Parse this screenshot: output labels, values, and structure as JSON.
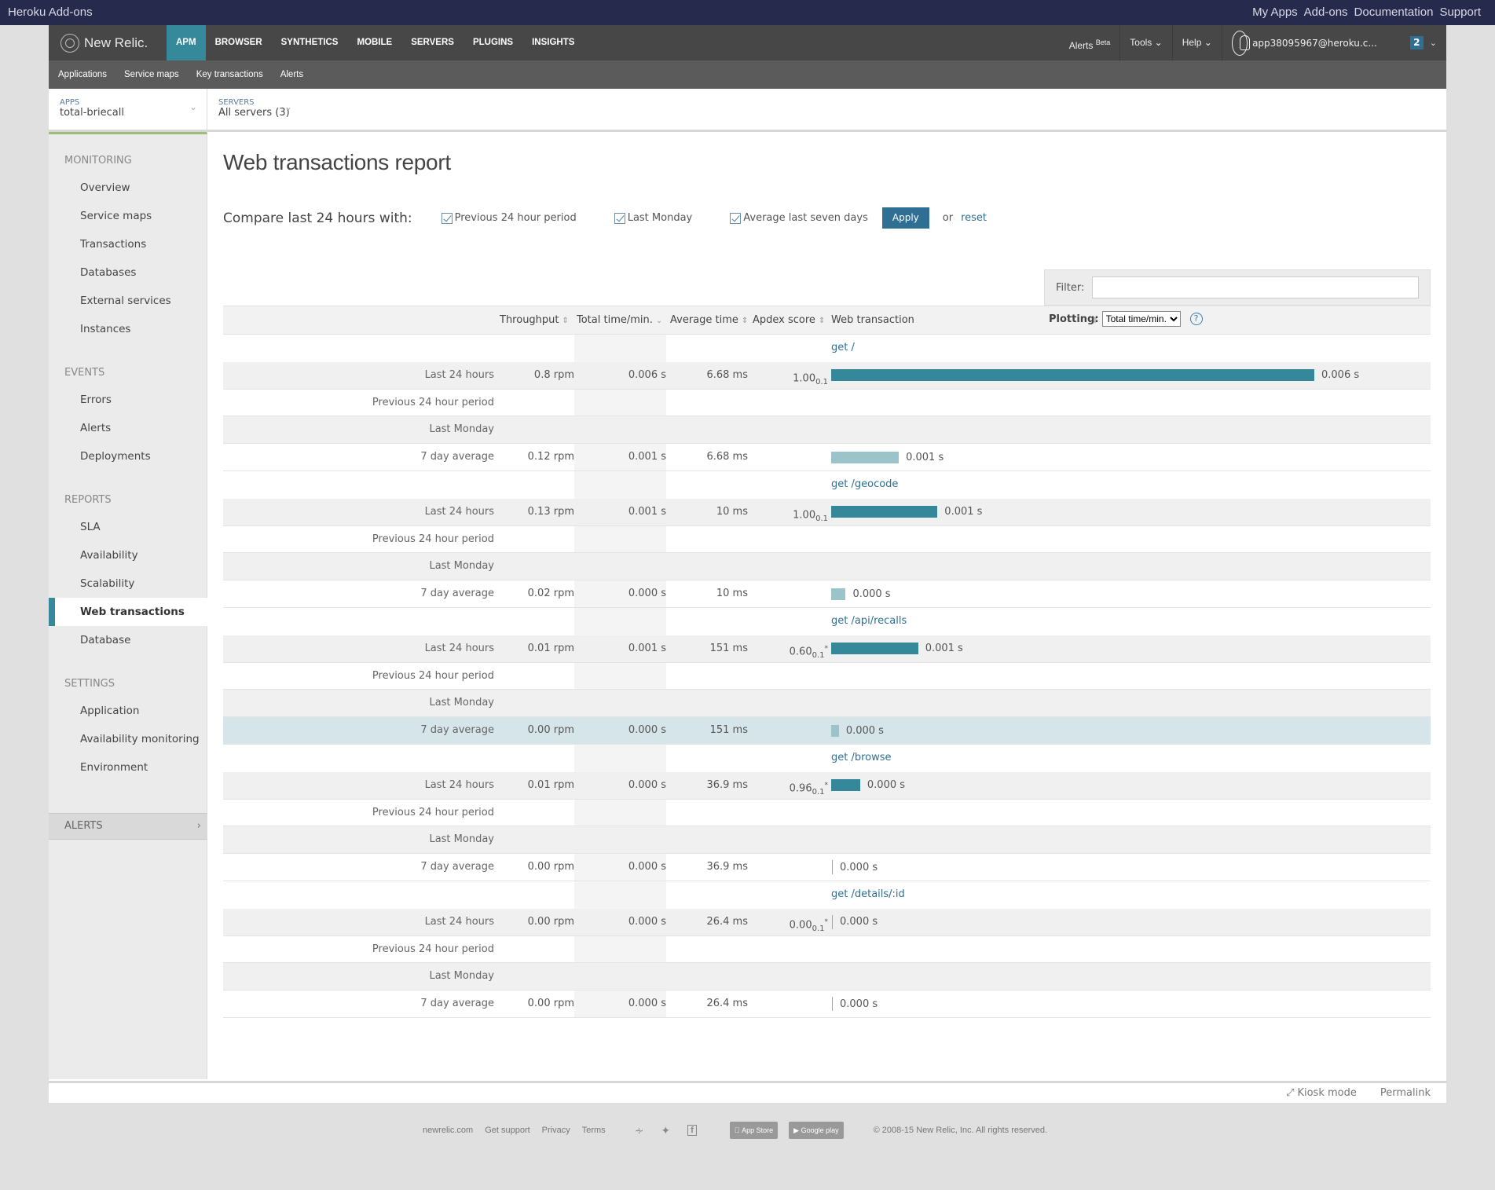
{
  "heroku": {
    "title": "Heroku Add-ons",
    "links": [
      "My Apps",
      "Add-ons",
      "Documentation",
      "Support"
    ]
  },
  "topnav": {
    "brand": "New Relic.",
    "tabs": [
      "APM",
      "BROWSER",
      "SYNTHETICS",
      "MOBILE",
      "SERVERS",
      "PLUGINS",
      "INSIGHTS"
    ],
    "active_tab": "APM",
    "alerts": "Alerts",
    "alerts_badge": "Beta",
    "tools": "Tools",
    "help": "Help",
    "user": "app38095967@heroku.c...",
    "notifications": "2"
  },
  "subnav": [
    "Applications",
    "Service maps",
    "Key transactions",
    "Alerts"
  ],
  "selectors": {
    "apps_label": "APPS",
    "apps_value": "total-briecall",
    "servers_label": "SERVERS",
    "servers_value": "All servers (3)"
  },
  "sidebar": {
    "sections": [
      {
        "heading": "MONITORING",
        "items": [
          "Overview",
          "Service maps",
          "Transactions",
          "Databases",
          "External services",
          "Instances"
        ]
      },
      {
        "heading": "EVENTS",
        "items": [
          "Errors",
          "Alerts",
          "Deployments"
        ]
      },
      {
        "heading": "REPORTS",
        "items": [
          "SLA",
          "Availability",
          "Scalability",
          "Web transactions",
          "Database"
        ]
      },
      {
        "heading": "SETTINGS",
        "items": [
          "Application",
          "Availability monitoring",
          "Environment"
        ]
      }
    ],
    "active_item": "Web transactions",
    "alerts_label": "ALERTS"
  },
  "main": {
    "title": "Web transactions report",
    "compare_label": "Compare last 24 hours with:",
    "checkboxes": [
      {
        "label": "Previous 24 hour period",
        "checked": true
      },
      {
        "label": "Last Monday",
        "checked": true
      },
      {
        "label": "Average last seven days",
        "checked": true
      }
    ],
    "apply": "Apply",
    "or": "or",
    "reset": "reset",
    "filter_label": "Filter:",
    "filter_value": "",
    "columns": [
      "Throughput",
      "Total time/min.",
      "Average time",
      "Apdex score",
      "Web transaction"
    ],
    "plotting_label": "Plotting:",
    "plotting_value": "Total time/min.",
    "help": "?",
    "transactions": [
      {
        "name": "get /",
        "rows": [
          {
            "label": "Last 24 hours",
            "throughput": "0.8 rpm",
            "total_time": "0.006 s",
            "avg_time": "6.68 ms",
            "apdex": "1.00",
            "apdex_t": "0.1",
            "apdex_star": "",
            "bar_fraction": 1.0,
            "bar_type": "main",
            "bar_label": "0.006 s"
          },
          {
            "label": "Previous 24 hour period"
          },
          {
            "label": "Last Monday"
          },
          {
            "label": "7 day average",
            "throughput": "0.12 rpm",
            "total_time": "0.001 s",
            "avg_time": "6.68 ms",
            "bar_fraction": 0.14,
            "bar_type": "avg",
            "bar_label": "0.001 s"
          }
        ]
      },
      {
        "name": "get /geocode",
        "rows": [
          {
            "label": "Last 24 hours",
            "throughput": "0.13 rpm",
            "total_time": "0.001 s",
            "avg_time": "10 ms",
            "apdex": "1.00",
            "apdex_t": "0.1",
            "apdex_star": "",
            "bar_fraction": 0.22,
            "bar_type": "main",
            "bar_label": "0.001 s"
          },
          {
            "label": "Previous 24 hour period"
          },
          {
            "label": "Last Monday"
          },
          {
            "label": "7 day average",
            "throughput": "0.02 rpm",
            "total_time": "0.000 s",
            "avg_time": "10 ms",
            "bar_fraction": 0.03,
            "bar_type": "avg",
            "bar_label": "0.000 s"
          }
        ]
      },
      {
        "name": "get /api/recalls",
        "rows": [
          {
            "label": "Last 24 hours",
            "throughput": "0.01 rpm",
            "total_time": "0.001 s",
            "avg_time": "151 ms",
            "apdex": "0.60",
            "apdex_t": "0.1",
            "apdex_star": "*",
            "bar_fraction": 0.18,
            "bar_type": "main",
            "bar_label": "0.001 s"
          },
          {
            "label": "Previous 24 hour period"
          },
          {
            "label": "Last Monday"
          },
          {
            "label": "7 day average",
            "throughput": "0.00 rpm",
            "total_time": "0.000 s",
            "avg_time": "151 ms",
            "bar_fraction": 0.016,
            "bar_type": "avg",
            "bar_label": "0.000 s",
            "highlight": true
          }
        ]
      },
      {
        "name": "get /browse",
        "rows": [
          {
            "label": "Last 24 hours",
            "throughput": "0.01 rpm",
            "total_time": "0.000 s",
            "avg_time": "36.9 ms",
            "apdex": "0.96",
            "apdex_t": "0.1",
            "apdex_star": "*",
            "bar_fraction": 0.06,
            "bar_type": "main",
            "bar_label": "0.000 s"
          },
          {
            "label": "Previous 24 hour period"
          },
          {
            "label": "Last Monday"
          },
          {
            "label": "7 day average",
            "throughput": "0.00 rpm",
            "total_time": "0.000 s",
            "avg_time": "36.9 ms",
            "bar_fraction": 0,
            "bar_type": "avg",
            "bar_label": "0.000 s"
          }
        ]
      },
      {
        "name": "get /details/:id",
        "rows": [
          {
            "label": "Last 24 hours",
            "throughput": "0.00 rpm",
            "total_time": "0.000 s",
            "avg_time": "26.4 ms",
            "apdex": "0.00",
            "apdex_t": "0.1",
            "apdex_star": "*",
            "bar_fraction": 0,
            "bar_type": "main",
            "bar_label": "0.000 s"
          },
          {
            "label": "Previous 24 hour period"
          },
          {
            "label": "Last Monday"
          },
          {
            "label": "7 day average",
            "throughput": "0.00 rpm",
            "total_time": "0.000 s",
            "avg_time": "26.4 ms",
            "bar_fraction": 0,
            "bar_type": "avg",
            "bar_label": "0.000 s"
          }
        ]
      }
    ]
  },
  "frame_footer": {
    "kiosk": "Kiosk mode",
    "permalink": "Permalink"
  },
  "page_footer": {
    "links": [
      "newrelic.com",
      "Get support",
      "Privacy",
      "Terms"
    ],
    "app_store": "App Store",
    "google_play": "Google play",
    "copyright": "© 2008-15 New Relic, Inc. All rights reserved."
  }
}
